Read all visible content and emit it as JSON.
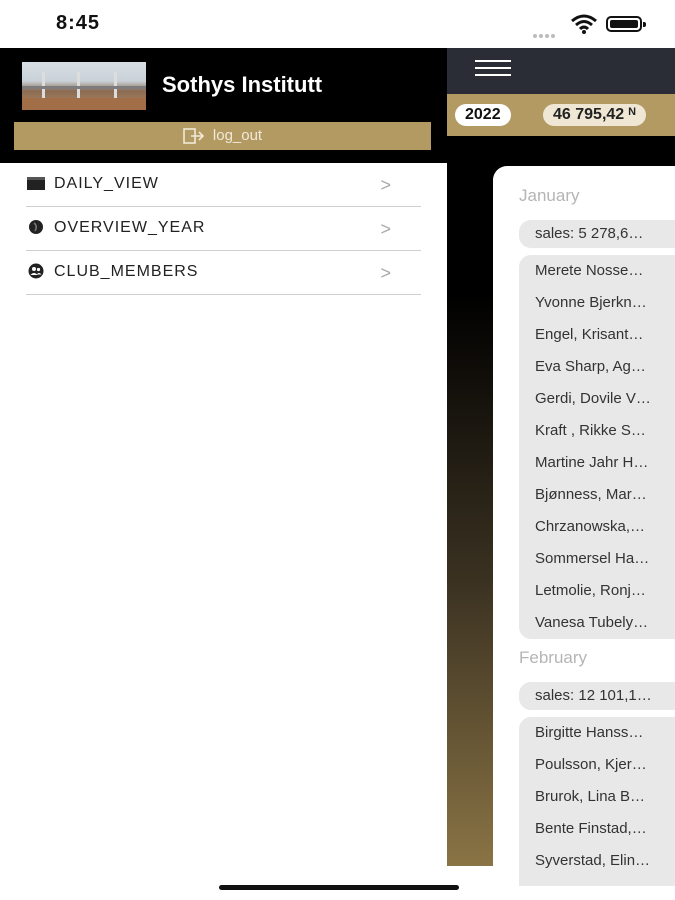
{
  "status": {
    "time": "8:45"
  },
  "sidebar": {
    "institute_name": "Sothys Institutt",
    "logout_label": "log_out",
    "items": [
      {
        "label": "DAILY_VIEW",
        "icon": "calendar-icon"
      },
      {
        "label": "OVERVIEW_YEAR",
        "icon": "globe-icon"
      },
      {
        "label": "CLUB_MEMBERS",
        "icon": "users-icon"
      }
    ]
  },
  "main": {
    "year": "2022",
    "total": "46 795,42 ᴺ",
    "months": [
      {
        "name": "January",
        "sales": "sales: 5 278,6…",
        "members": [
          "Merete Nosse…",
          "Yvonne Bjerkn…",
          "Engel, Krisant…",
          "Eva Sharp, Ag…",
          "Gerdi, Dovile V…",
          "Kraft , Rikke S…",
          "Martine Jahr H…",
          "Bjønness, Mar…",
          "Chrzanowska,…",
          "Sommersel Ha…",
          "Letmolie, Ronj…",
          "Vanesa Tubely…"
        ]
      },
      {
        "name": "February",
        "sales": "sales: 12 101,1…",
        "members": [
          "Birgitte Hanss…",
          "Poulsson, Kjer…",
          "Brurok, Lina B…",
          "Bente Finstad,…",
          "Syverstad, Elin…"
        ]
      }
    ]
  },
  "colors": {
    "accent": "#b39a63",
    "topbar": "#2a2d36"
  }
}
